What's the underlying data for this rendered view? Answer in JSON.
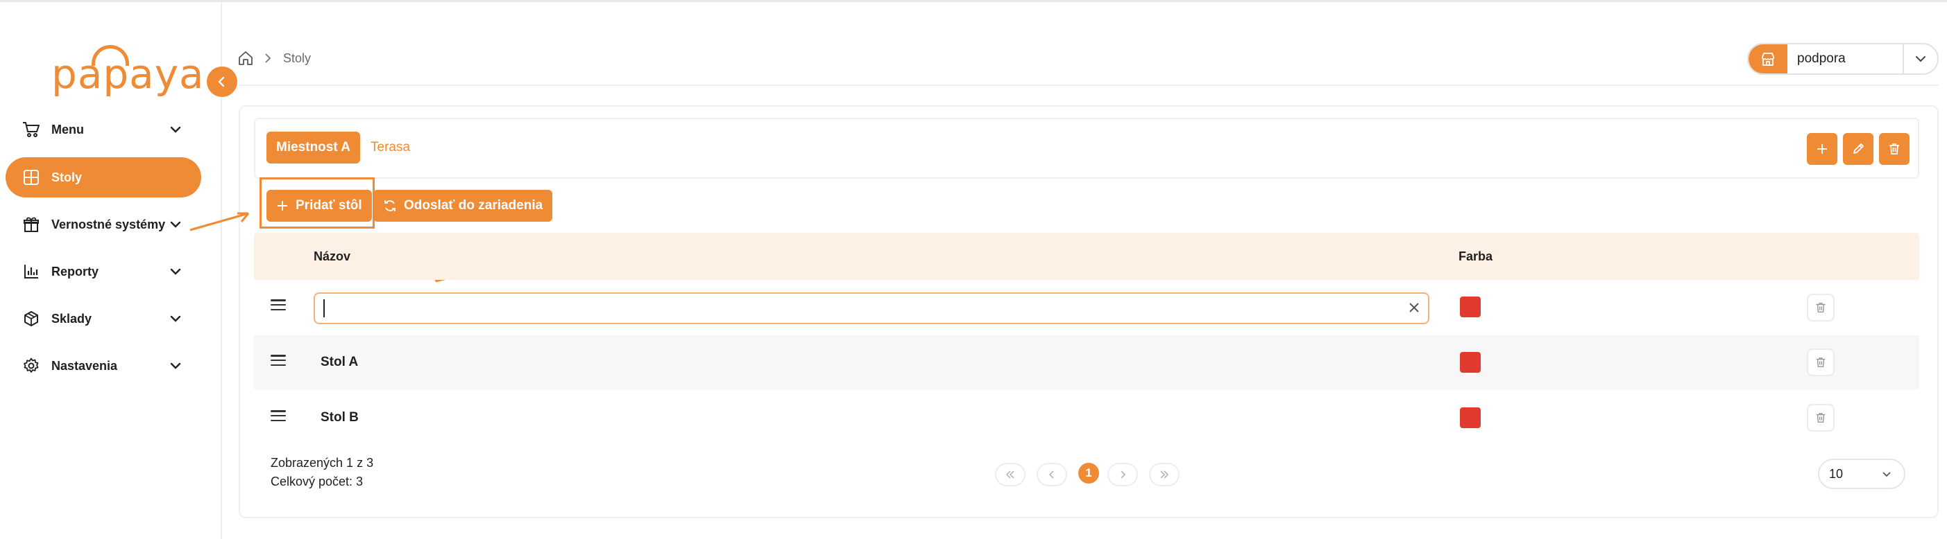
{
  "brand": {
    "logo_text": "papaya",
    "accent": "#ef8a35",
    "swatch_color": "#e13a2f"
  },
  "sidebar": {
    "items": [
      {
        "label": "Menu",
        "icon": "cart-icon",
        "expandable": true,
        "active": false
      },
      {
        "label": "Stoly",
        "icon": "grid-icon",
        "expandable": false,
        "active": true
      },
      {
        "label": "Vernostné systémy",
        "icon": "gift-icon",
        "expandable": true,
        "active": false
      },
      {
        "label": "Reporty",
        "icon": "bar-chart-icon",
        "expandable": true,
        "active": false
      },
      {
        "label": "Sklady",
        "icon": "box-icon",
        "expandable": true,
        "active": false
      },
      {
        "label": "Nastavenia",
        "icon": "gear-icon",
        "expandable": true,
        "active": false
      }
    ]
  },
  "header": {
    "breadcrumb": {
      "current": "Stoly"
    },
    "store_select": {
      "value": "podpora"
    }
  },
  "rooms": {
    "tabs": [
      {
        "label": "Miestnost A",
        "active": true
      },
      {
        "label": "Terasa",
        "active": false
      }
    ]
  },
  "actions": {
    "add_table": "Pridať stôl",
    "send_to_device": "Odoslať do zariadenia"
  },
  "table": {
    "columns": {
      "name": "Názov",
      "color": "Farba"
    },
    "new_row": {
      "value": "",
      "placeholder": ""
    },
    "rows": [
      {
        "name": "Stol A"
      },
      {
        "name": "Stol B"
      }
    ]
  },
  "footer": {
    "shown": "Zobrazených 1 z 3",
    "total": "Celkový počet: 3",
    "page": "1",
    "per_page": "10"
  }
}
